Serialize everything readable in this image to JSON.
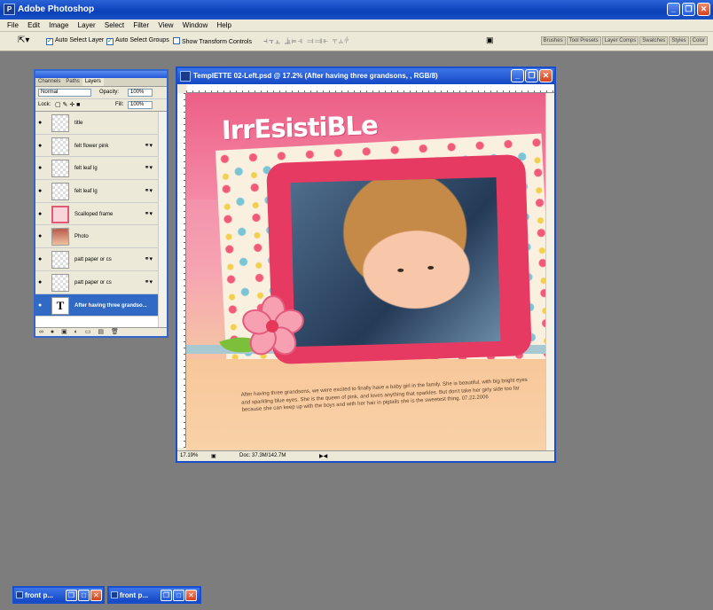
{
  "app": {
    "title": "Adobe Photoshop"
  },
  "menu": [
    "File",
    "Edit",
    "Image",
    "Layer",
    "Select",
    "Filter",
    "View",
    "Window",
    "Help"
  ],
  "options": {
    "auto_select_layer": "Auto Select Layer",
    "auto_select_groups": "Auto Select Groups",
    "show_transform": "Show Transform Controls",
    "well_tabs": [
      "Brushes",
      "Tool Presets",
      "Layer Comps",
      "Swatches",
      "Styles",
      "Color"
    ]
  },
  "layers_panel": {
    "tabs": [
      "Channels",
      "Paths",
      "Layers"
    ],
    "blend_mode": "Normal",
    "opacity_label": "Opacity:",
    "opacity_value": "100%",
    "lock_label": "Lock:",
    "fill_label": "Fill:",
    "fill_value": "100%",
    "layers": [
      {
        "name": "title",
        "thumb": "checker",
        "linked": false,
        "selected": false
      },
      {
        "name": "felt flower pink",
        "thumb": "checker",
        "linked": true,
        "selected": false
      },
      {
        "name": "felt leaf lg",
        "thumb": "checker",
        "linked": true,
        "selected": false
      },
      {
        "name": "felt leaf lg",
        "thumb": "checker",
        "linked": true,
        "selected": false
      },
      {
        "name": "Scalloped frame",
        "thumb": "frame",
        "linked": true,
        "selected": false
      },
      {
        "name": "Photo",
        "thumb": "photo",
        "linked": false,
        "selected": false
      },
      {
        "name": "patt paper or cs",
        "thumb": "checker",
        "linked": true,
        "selected": false
      },
      {
        "name": "patt paper or cs",
        "thumb": "checker",
        "linked": true,
        "selected": false
      },
      {
        "name": "After having three grandso...",
        "thumb": "text",
        "linked": false,
        "selected": true
      }
    ]
  },
  "document": {
    "title": "TempIETTE 02-Left.psd @ 17.2% (After having three grandsons, , RGB/8)",
    "zoom": "17.19%",
    "doc_size": "Doc: 37.3M/142.7M",
    "page_title": "IrrEsistiBLe",
    "journal": "After having three grandsons, we were excited to finally have a baby girl in the family. She is beautiful, with big bright eyes and sparkling blue eyes. She is the queen of pink, and loves anything that sparkles. But don't take her girly side too far because she can keep up with the boys and with her hair in pigtails she is the sweetest thing. 07.22.2006"
  },
  "taskbar": [
    {
      "label": "front p..."
    },
    {
      "label": "front p..."
    }
  ],
  "colors": {
    "accent": "#316ac5",
    "titlebar": "#1447c4",
    "workspace": "#7d7d7d"
  }
}
